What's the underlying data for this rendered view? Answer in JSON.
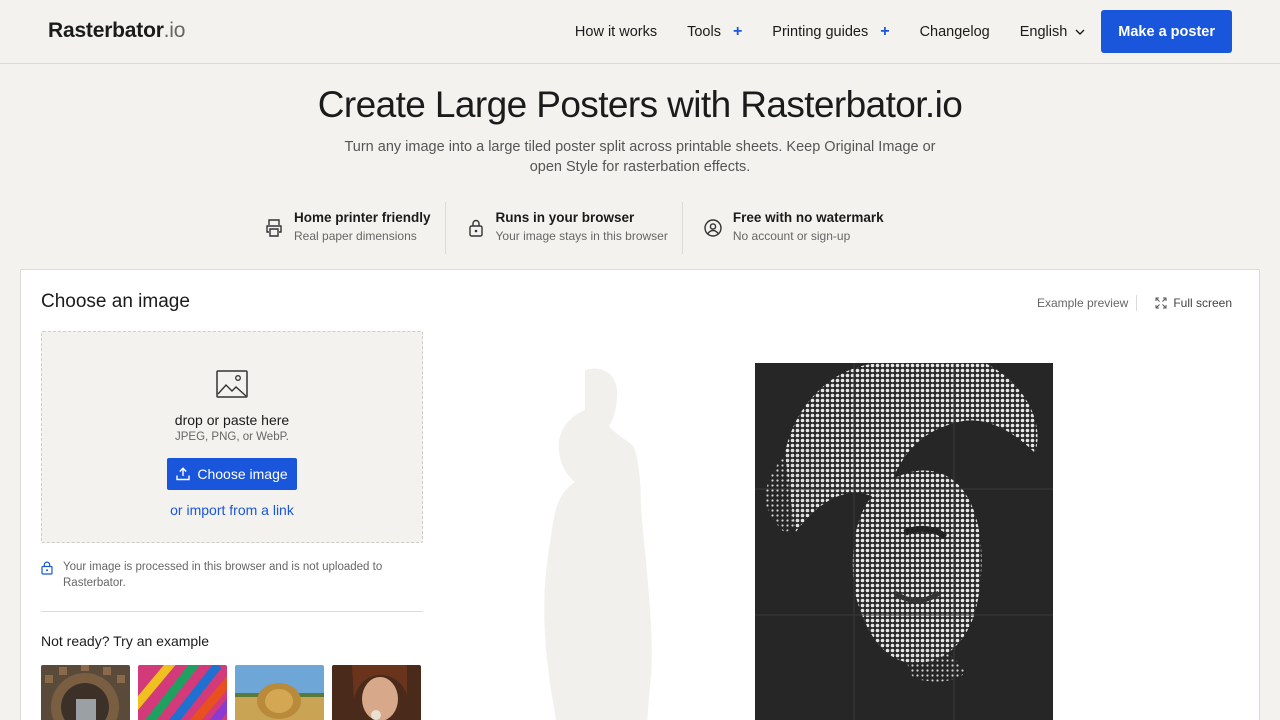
{
  "header": {
    "logo_main": "Rasterbator",
    "logo_tld": ".io",
    "nav": [
      {
        "label": "How it works"
      },
      {
        "label": "Tools",
        "plus": "+"
      },
      {
        "label": "Printing guides",
        "plus": "+"
      },
      {
        "label": "Changelog"
      },
      {
        "label": "English"
      }
    ],
    "cta": "Make a poster"
  },
  "hero": {
    "title": "Create Large Posters with Rasterbator.io",
    "subtitle": "Turn any image into a large tiled poster split across printable sheets. Keep Original Image or open Style for rasterbation effects."
  },
  "features": [
    {
      "title": "Home printer friendly",
      "desc": "Real paper dimensions",
      "icon": "printer-icon"
    },
    {
      "title": "Runs in your browser",
      "desc": "Your image stays in this browser",
      "icon": "lock-icon"
    },
    {
      "title": "Free with no watermark",
      "desc": "No account or sign-up",
      "icon": "user-circle-icon"
    }
  ],
  "card": {
    "title": "Choose an image",
    "example_preview": "Example preview",
    "full_screen": "Full screen",
    "dropzone": {
      "text": "drop or paste here",
      "hint": "JPEG, PNG, or WebP.",
      "button": "Choose image",
      "link": "or import from a link"
    },
    "privacy": "Your image is processed in this browser and is not uploaded to Rasterbator.",
    "examples_title": "Not ready? Try an example"
  },
  "colors": {
    "accent": "#1a56db",
    "background": "#f3f2ee"
  }
}
